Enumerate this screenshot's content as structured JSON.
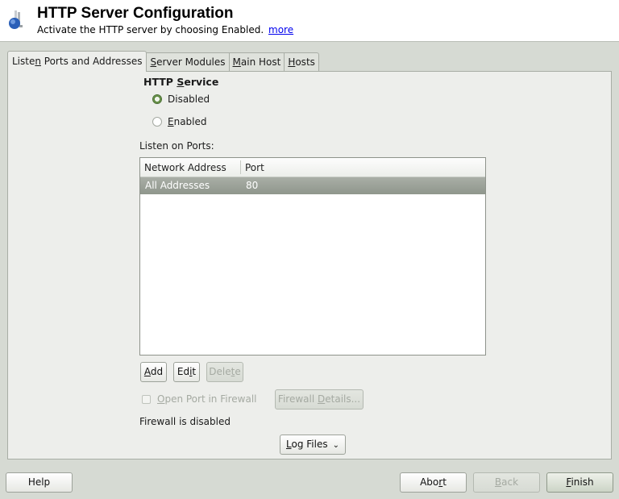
{
  "header": {
    "icon": "http-server-icon",
    "title": "HTTP Server Configuration",
    "subtitle": "Activate the HTTP server by choosing Enabled.",
    "more_link": "more"
  },
  "tabs": [
    {
      "pre": "Liste",
      "ul": "n",
      "post": " Ports and Addresses",
      "active": true
    },
    {
      "pre": "",
      "ul": "S",
      "post": "erver Modules",
      "active": false
    },
    {
      "pre": "",
      "ul": "M",
      "post": "ain Host",
      "active": false
    },
    {
      "pre": "",
      "ul": "H",
      "post": "osts",
      "active": false
    }
  ],
  "service": {
    "title_pre": "HTTP ",
    "title_ul": "S",
    "title_post": "ervice",
    "options": [
      {
        "pre": "",
        "ul": "",
        "post": "Disabled",
        "checked": true
      },
      {
        "pre": "",
        "ul": "E",
        "post": "nabled",
        "checked": false
      }
    ]
  },
  "ports": {
    "label": "Listen on Ports:",
    "columns": [
      "Network Address",
      "Port"
    ],
    "rows": [
      {
        "address": "All Addresses",
        "port": "80",
        "selected": true
      }
    ]
  },
  "table_buttons": {
    "add": {
      "ul": "A",
      "post": "dd"
    },
    "edit": {
      "pre": "Ed",
      "ul": "i",
      "post": "t"
    },
    "delete": {
      "pre": "Dele",
      "ul": "t",
      "post": "e",
      "disabled": true
    }
  },
  "firewall": {
    "open_port": {
      "ul": "O",
      "post": "pen Port in Firewall",
      "checked": false,
      "disabled": true
    },
    "details": {
      "pre": "Firewall ",
      "ul": "D",
      "post": "etails...",
      "disabled": true
    },
    "status": "Firewall is disabled"
  },
  "log_files": {
    "ul": "L",
    "post": "og Files",
    "icon": "chevron-down-icon"
  },
  "footer": {
    "help": "Help",
    "abort": {
      "pre": "Abo",
      "ul": "r",
      "post": "t"
    },
    "back": {
      "ul": "B",
      "post": "ack",
      "disabled": true
    },
    "finish": {
      "ul": "F",
      "post": "inish"
    }
  }
}
